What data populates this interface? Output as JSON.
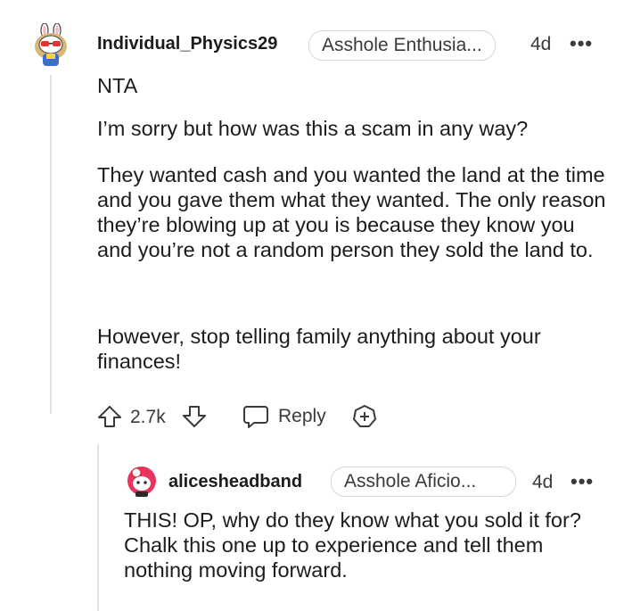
{
  "comment": {
    "username": "Individual_Physics29",
    "flair": "Asshole Enthusia...",
    "age": "4d",
    "more": "•••",
    "paragraphs": [
      "NTA",
      "I’m sorry but how was this a scam in any way?",
      "They wanted cash and you wanted the land at the time and you gave them what they wanted. The only reason they’re blowing up at you is because they know you and you’re not a random person they sold the land to.",
      "However, stop telling family anything about your finances!"
    ],
    "votes": "2.7k",
    "reply_label": "Reply"
  },
  "reply": {
    "username": "alicesheadband",
    "flair": "Asshole Aficio...",
    "age": "4d",
    "more": "•••",
    "text": "THIS! OP, why do they know what you sold it for? Chalk this one up to experience and tell them nothing moving forward."
  }
}
